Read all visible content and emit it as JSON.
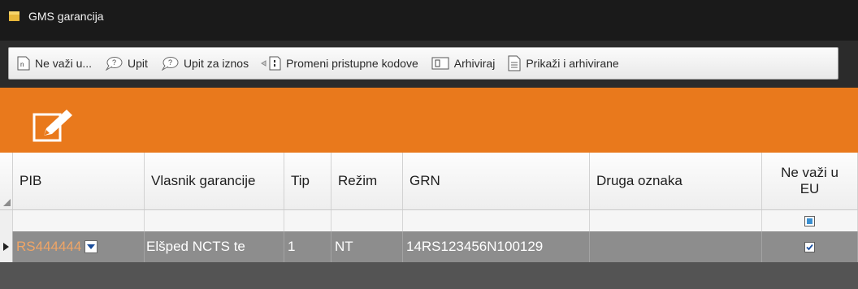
{
  "window": {
    "title": "GMS garancija",
    "icon": "folder-icon"
  },
  "toolbar": {
    "items": [
      {
        "label": "Ne važi u...",
        "icon": "document-n-icon"
      },
      {
        "label": "Upit",
        "icon": "speech-question-icon"
      },
      {
        "label": "Upit za iznos",
        "icon": "speech-question-icon"
      },
      {
        "label": "Promeni pristupne kodove",
        "icon": "code-change-icon"
      },
      {
        "label": "Arhiviraj",
        "icon": "archive-icon"
      },
      {
        "label": "Prikaži i arhivirane",
        "icon": "document-list-icon"
      }
    ]
  },
  "banner": {
    "color": "#e9791c",
    "icon": "edit-icon"
  },
  "grid": {
    "columns": [
      "PIB",
      "Vlasnik garancije",
      "Tip",
      "Režim",
      "GRN",
      "Druga oznaka",
      "Ne važi u EU"
    ],
    "rows": [
      {
        "pib": "RS444444",
        "vlasnik": "Elšped NCTS te",
        "tip": "1",
        "rezim": "NT",
        "grn": "14RS123456N100129",
        "druga": "",
        "ne_vazi_u_eu": true
      }
    ]
  }
}
